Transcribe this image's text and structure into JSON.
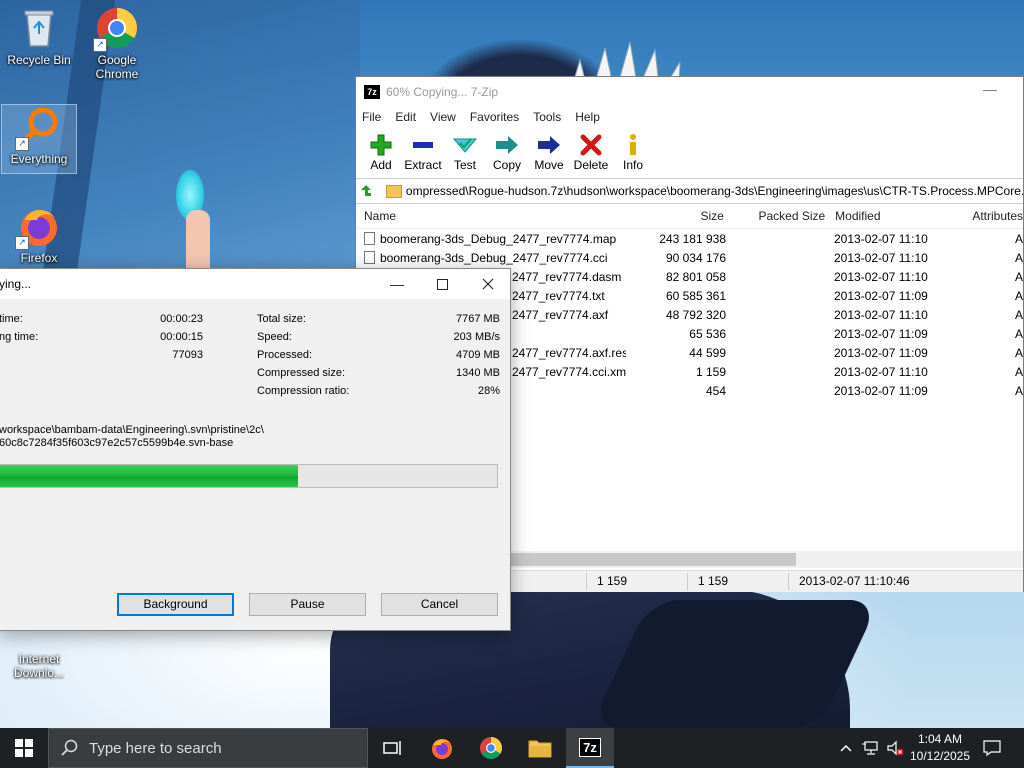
{
  "desktop": {
    "icons": [
      {
        "label": "Recycle Bin",
        "icon": "recycle-bin-icon"
      },
      {
        "label": "Google Chrome",
        "icon": "chrome-icon"
      },
      {
        "label": "Everything",
        "icon": "everything-search-icon"
      },
      {
        "label": "Firefox",
        "icon": "firefox-icon"
      },
      {
        "label": "Internet Downlo...",
        "icon": "idm-icon"
      }
    ]
  },
  "zip_window": {
    "title": "60% Copying... 7-Zip",
    "app_icon_text": "7z",
    "menu": [
      "File",
      "Edit",
      "View",
      "Favorites",
      "Tools",
      "Help"
    ],
    "toolbar": [
      {
        "label": "Add",
        "icon": "add-icon",
        "color": "#1faa1f"
      },
      {
        "label": "Extract",
        "icon": "extract-icon",
        "color": "#1a2fb3"
      },
      {
        "label": "Test",
        "icon": "test-icon",
        "color": "#2aa7b8"
      },
      {
        "label": "Copy",
        "icon": "copy-icon",
        "color": "#1d8f8f"
      },
      {
        "label": "Move",
        "icon": "move-icon",
        "color": "#1a2f9a"
      },
      {
        "label": "Delete",
        "icon": "delete-icon",
        "color": "#d01818"
      },
      {
        "label": "Info",
        "icon": "info-icon",
        "color": "#e0b000"
      }
    ],
    "address": "ompressed\\Rogue-hudson.7z\\hudson\\workspace\\boomerang-3ds\\Engineering\\images\\us\\CTR-TS.Process.MPCore.",
    "columns": {
      "name": "Name",
      "size": "Size",
      "packed": "Packed Size",
      "modified": "Modified",
      "attributes": "Attributes"
    },
    "files": [
      {
        "name": "boomerang-3ds_Debug_2477_rev7774.map",
        "size": "243 181 938",
        "packed": "",
        "modified": "2013-02-07 11:10",
        "attr": "A"
      },
      {
        "name": "boomerang-3ds_Debug_2477_rev7774.cci",
        "size": "90 034 176",
        "packed": "",
        "modified": "2013-02-07 11:10",
        "attr": "A"
      },
      {
        "name": "2477_rev7774.dasm",
        "size": "82 801 058",
        "packed": "",
        "modified": "2013-02-07 11:10",
        "attr": "A"
      },
      {
        "name": "2477_rev7774.txt",
        "size": "60 585 361",
        "packed": "",
        "modified": "2013-02-07 11:09",
        "attr": "A"
      },
      {
        "name": "2477_rev7774.axf",
        "size": "48 792 320",
        "packed": "",
        "modified": "2013-02-07 11:10",
        "attr": "A"
      },
      {
        "name": "",
        "size": "65 536",
        "packed": "",
        "modified": "2013-02-07 11:09",
        "attr": "A"
      },
      {
        "name": "2477_rev7774.axf.res",
        "size": "44 599",
        "packed": "",
        "modified": "2013-02-07 11:09",
        "attr": "A"
      },
      {
        "name": "2477_rev7774.cci.xml",
        "size": "1 159",
        "packed": "",
        "modified": "2013-02-07 11:10",
        "attr": "A"
      },
      {
        "name": "",
        "size": "454",
        "packed": "",
        "modified": "2013-02-07 11:09",
        "attr": "A"
      }
    ],
    "status": [
      "1 159",
      "1 159",
      "2013-02-07 11:10:46"
    ]
  },
  "progress_dialog": {
    "title": "ying...",
    "left_rows": [
      {
        "label": "time:",
        "value": "00:00:23"
      },
      {
        "label": "ng time:",
        "value": "00:00:15"
      },
      {
        "label": "",
        "value": "77093"
      }
    ],
    "right_rows": [
      {
        "label": "Total size:",
        "value": "7767 MB"
      },
      {
        "label": "Speed:",
        "value": "203 MB/s"
      },
      {
        "label": "Processed:",
        "value": "4709 MB"
      },
      {
        "label": "Compressed size:",
        "value": "1340 MB"
      },
      {
        "label": "Compression ratio:",
        "value": "28%"
      }
    ],
    "path_line1": "workspace\\bambam-data\\Engineering\\.svn\\pristine\\2c\\",
    "path_line2": "60c8c7284f35f603c97e2c57c5599b4e.svn-base",
    "progress": 0.6,
    "buttons": {
      "background": "Background",
      "pause": "Pause",
      "cancel": "Cancel"
    }
  },
  "taskbar": {
    "search_placeholder": "Type here to search",
    "time": "1:04 AM",
    "date": "10/12/2025"
  }
}
